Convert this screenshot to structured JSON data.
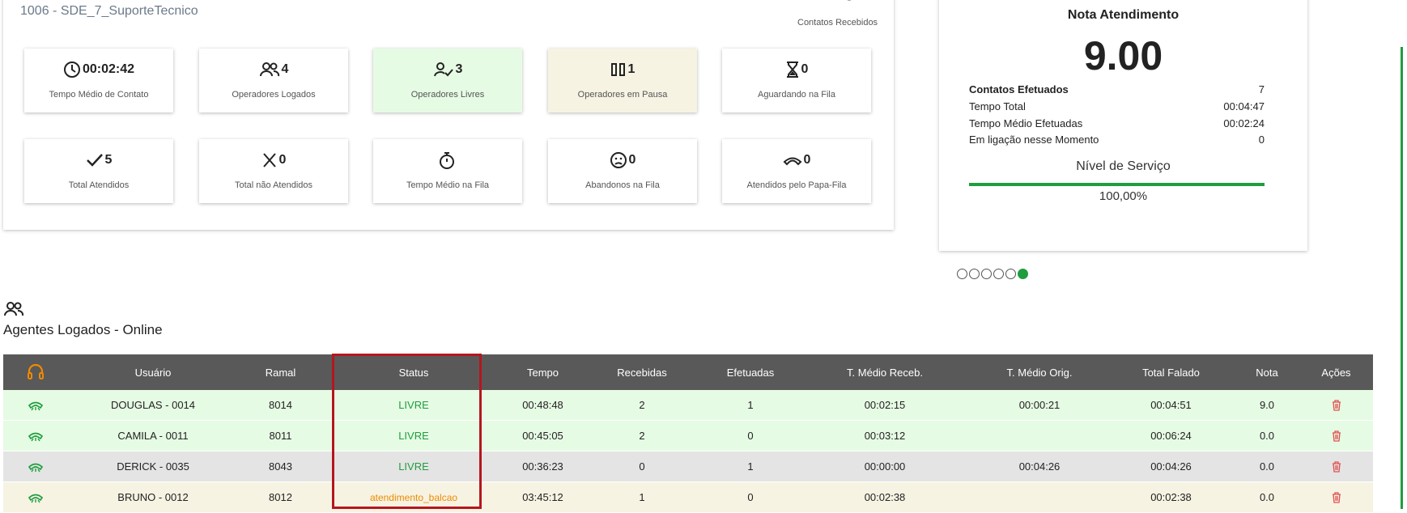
{
  "header": {
    "queue_title": "1006 - SDE_7_SuporteTecnico",
    "contatos_label": "Contatos Recebidos"
  },
  "cards": [
    {
      "icon": "clock-icon",
      "value": "00:02:42",
      "label": "Tempo Médio de Contato"
    },
    {
      "icon": "users-icon",
      "value": "4",
      "label": "Operadores Logados"
    },
    {
      "icon": "user-check-icon",
      "value": "3",
      "label": "Operadores Livres"
    },
    {
      "icon": "pause-icon",
      "value": "1",
      "label": "Operadores em Pausa"
    },
    {
      "icon": "hourglass-icon",
      "value": "0",
      "label": "Aguardando na Fila"
    },
    {
      "icon": "check-icon",
      "value": "5",
      "label": "Total Atendidos"
    },
    {
      "icon": "x-icon",
      "value": "0",
      "label": "Total não Atendidos"
    },
    {
      "icon": "stopwatch-icon",
      "value": "",
      "label": "Tempo Médio na Fila"
    },
    {
      "icon": "sad-face-icon",
      "value": "0",
      "label": "Abandonos na Fila"
    },
    {
      "icon": "phone-hangup-icon",
      "value": "0",
      "label": "Atendidos pelo Papa-Fila"
    }
  ],
  "rating": {
    "title": "Nota Atendimento",
    "score": "9.00",
    "rows": [
      {
        "k": "Contatos Efetuados",
        "v": "7"
      },
      {
        "k": "Tempo Total",
        "v": "00:04:47"
      },
      {
        "k": "Tempo Médio Efetuadas",
        "v": "00:02:24"
      },
      {
        "k": "Em ligação nesse Momento",
        "v": "0"
      }
    ],
    "nivel_label": "Nível de Serviço",
    "nivel_value": "100,00%",
    "nivel_fraction": 1.0,
    "accent": "#1e9e3e"
  },
  "carousel": {
    "count": 6,
    "active_index": 5
  },
  "agents": {
    "title": "Agentes Logados - Online",
    "columns": [
      "",
      "Usuário",
      "Ramal",
      "Status",
      "Tempo",
      "Recebidas",
      "Efetuadas",
      "T. Médio Receb.",
      "T. Médio Orig.",
      "Total Falado",
      "Nota",
      "Ações"
    ],
    "rows": [
      {
        "usuario": "DOUGLAS - 0014",
        "ramal": "8014",
        "status": "LIVRE",
        "tempo": "00:48:48",
        "recebidas": "2",
        "efetuadas": "1",
        "tmr": "00:02:15",
        "tmo": "00:00:21",
        "total": "00:04:51",
        "nota": "9.0",
        "tone": "green",
        "status_tone": "livre"
      },
      {
        "usuario": "CAMILA - 0011",
        "ramal": "8011",
        "status": "LIVRE",
        "tempo": "00:45:05",
        "recebidas": "2",
        "efetuadas": "0",
        "tmr": "00:03:12",
        "tmo": "",
        "total": "00:06:24",
        "nota": "0.0",
        "tone": "green",
        "status_tone": "livre"
      },
      {
        "usuario": "DERICK - 0035",
        "ramal": "8043",
        "status": "LIVRE",
        "tempo": "00:36:23",
        "recebidas": "0",
        "efetuadas": "1",
        "tmr": "00:00:00",
        "tmo": "00:04:26",
        "total": "00:04:26",
        "nota": "0.0",
        "tone": "grey",
        "status_tone": "livre"
      },
      {
        "usuario": "BRUNO - 0012",
        "ramal": "8012",
        "status": "atendimento_balcao",
        "tempo": "03:45:12",
        "recebidas": "1",
        "efetuadas": "0",
        "tmr": "00:02:38",
        "tmo": "",
        "total": "00:02:38",
        "nota": "0.0",
        "tone": "beige",
        "status_tone": "balcao"
      }
    ]
  }
}
